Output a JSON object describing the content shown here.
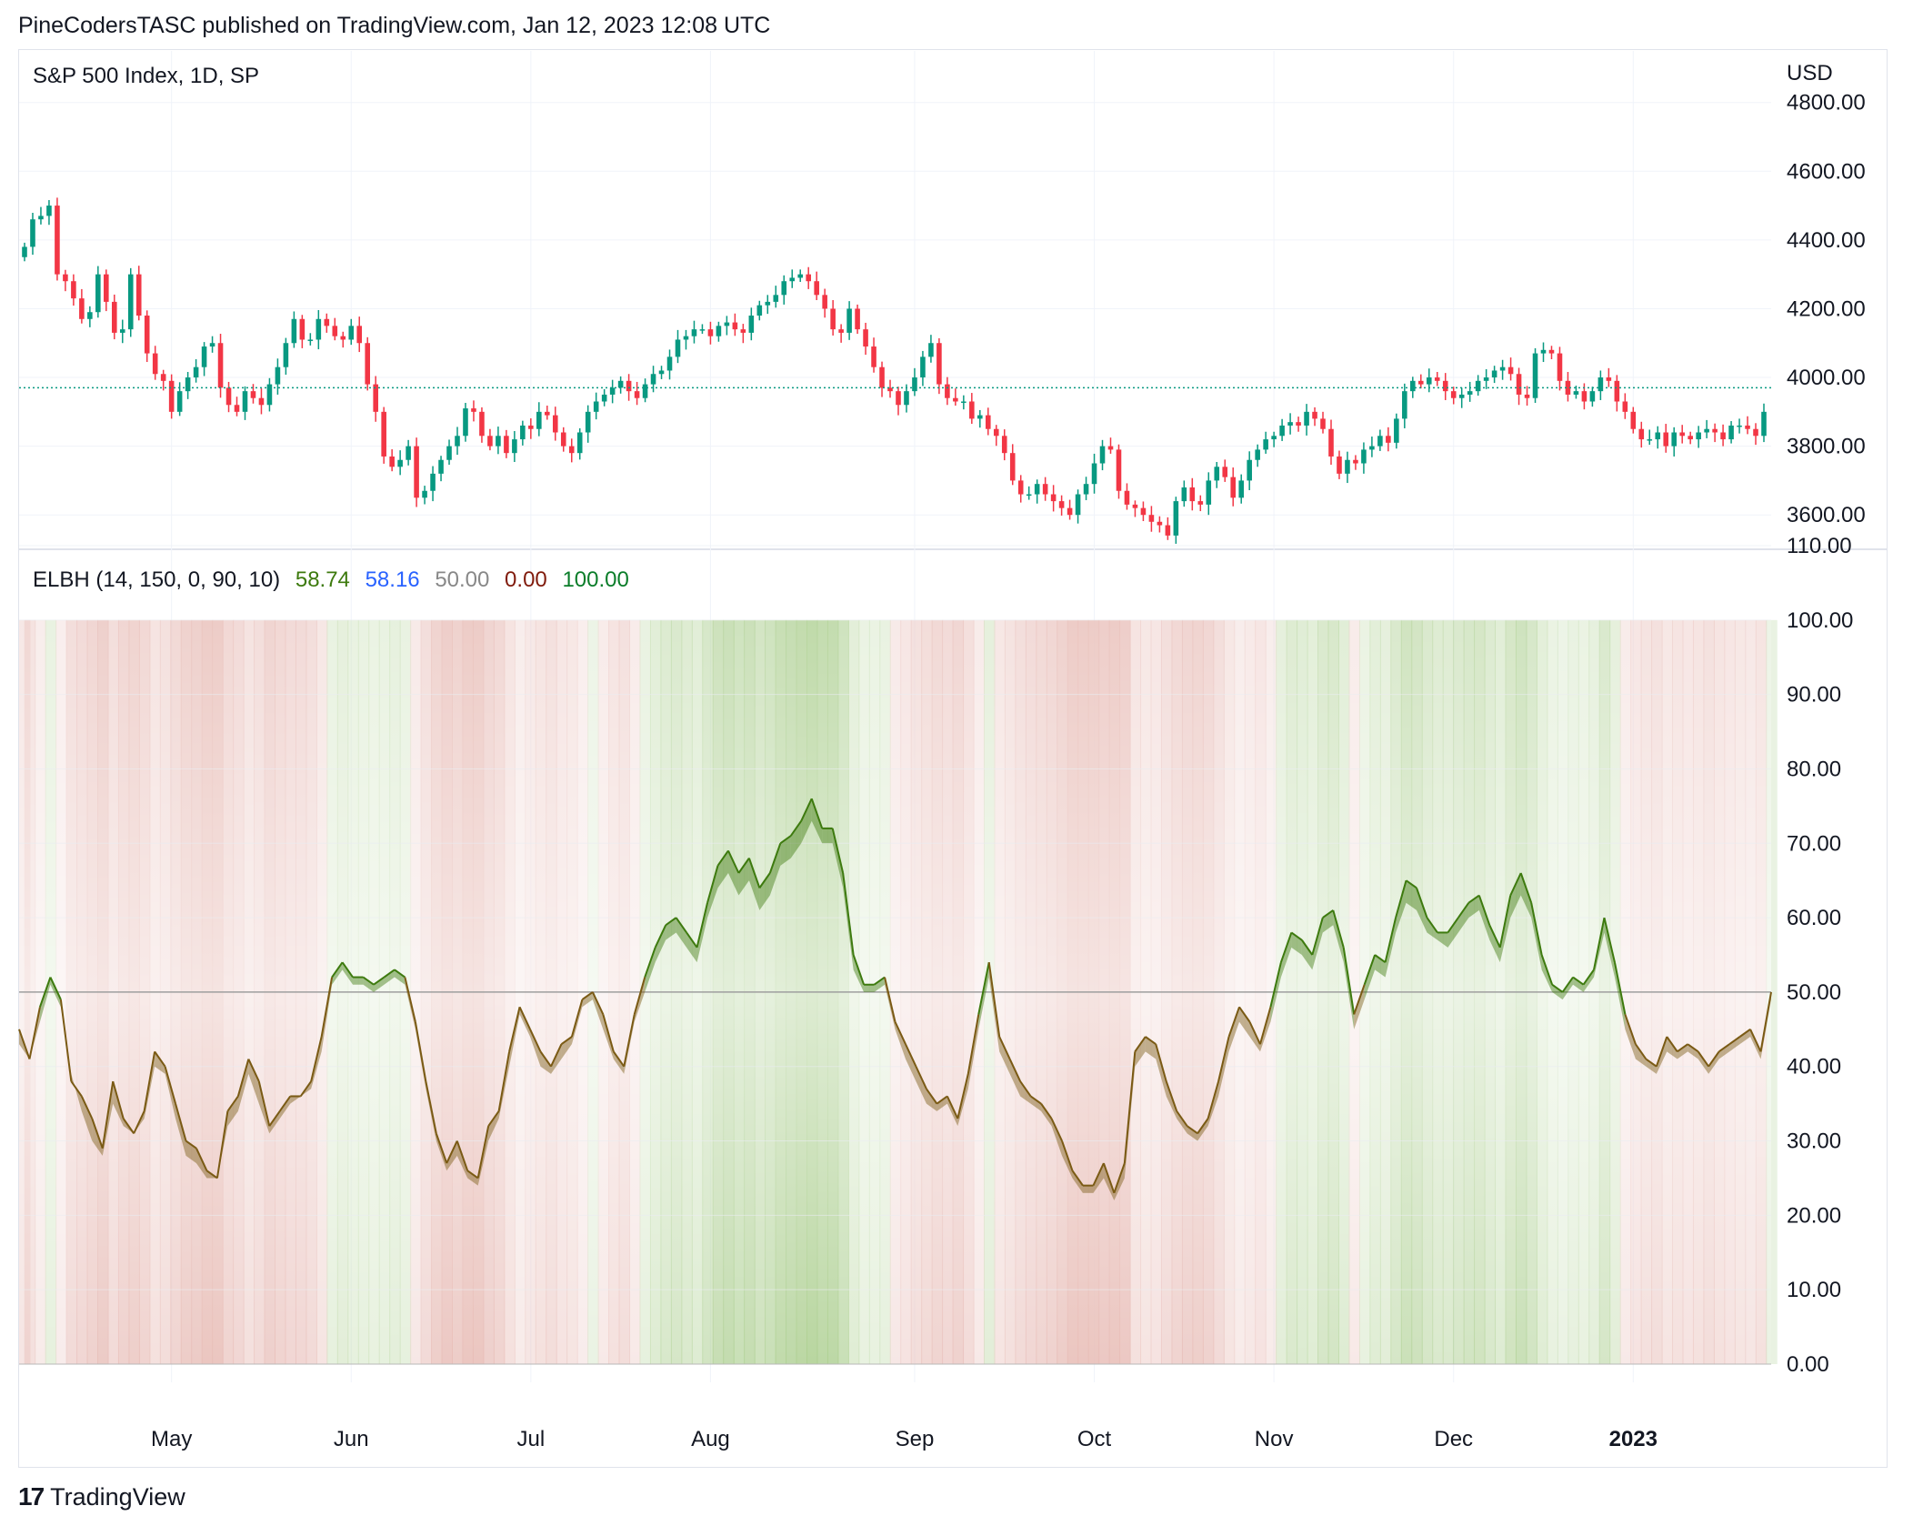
{
  "header": {
    "published": "PineCodersTASC published on TradingView.com, Jan 12, 2023 12:08 UTC"
  },
  "footer": {
    "brand": "TradingView",
    "logo_icon": "tradingview-logo-icon"
  },
  "chart_data": [
    {
      "type": "candlestick",
      "title": "S&P 500 Index, 1D, SP",
      "currency_label": "USD",
      "y_ticks": [
        "4800.00",
        "4600.00",
        "4400.00",
        "4200.00",
        "4000.00",
        "3800.00",
        "3600.00"
      ],
      "ylim": [
        3500,
        4950
      ],
      "last_price_line": 3970,
      "x_month_labels": [
        "May",
        "Jun",
        "Jul",
        "Aug",
        "Sep",
        "Oct",
        "Nov",
        "Dec",
        "2023"
      ],
      "grid": true,
      "colors": {
        "up": "#089981",
        "down": "#f23645",
        "price_line": "#089981"
      },
      "closes": [
        4380,
        4460,
        4470,
        4500,
        4300,
        4280,
        4230,
        4170,
        4190,
        4300,
        4220,
        4130,
        4140,
        4300,
        4180,
        4070,
        4010,
        3990,
        3900,
        3960,
        4000,
        4030,
        4090,
        4100,
        3970,
        3920,
        3900,
        3960,
        3940,
        3920,
        3980,
        4030,
        4100,
        4170,
        4110,
        4110,
        4170,
        4150,
        4120,
        4110,
        4150,
        4100,
        3980,
        3900,
        3770,
        3740,
        3760,
        3800,
        3650,
        3670,
        3720,
        3760,
        3800,
        3830,
        3910,
        3900,
        3830,
        3800,
        3830,
        3780,
        3820,
        3860,
        3850,
        3900,
        3890,
        3840,
        3800,
        3780,
        3840,
        3900,
        3930,
        3950,
        3970,
        3990,
        3960,
        3940,
        3980,
        4010,
        4020,
        4060,
        4110,
        4120,
        4140,
        4140,
        4120,
        4150,
        4160,
        4140,
        4130,
        4180,
        4210,
        4220,
        4240,
        4280,
        4290,
        4300,
        4280,
        4240,
        4200,
        4140,
        4130,
        4200,
        4140,
        4090,
        4030,
        3970,
        3960,
        3920,
        3960,
        4000,
        4060,
        4100,
        3980,
        3940,
        3930,
        3930,
        3880,
        3890,
        3850,
        3830,
        3780,
        3700,
        3660,
        3660,
        3690,
        3660,
        3640,
        3620,
        3600,
        3660,
        3690,
        3750,
        3800,
        3790,
        3670,
        3630,
        3620,
        3600,
        3580,
        3570,
        3540,
        3640,
        3680,
        3640,
        3630,
        3700,
        3740,
        3710,
        3650,
        3700,
        3760,
        3790,
        3820,
        3830,
        3860,
        3870,
        3860,
        3900,
        3880,
        3850,
        3770,
        3720,
        3760,
        3750,
        3790,
        3800,
        3830,
        3810,
        3880,
        3960,
        3990,
        3980,
        4000,
        3990,
        3960,
        3940,
        3950,
        3960,
        3990,
        4000,
        4020,
        4030,
        4010,
        3950,
        3940,
        4070,
        4080,
        4070,
        3990,
        3950,
        3960,
        3930,
        3960,
        4000,
        3990,
        3930,
        3900,
        3850,
        3820,
        3820,
        3840,
        3800,
        3840,
        3830,
        3820,
        3840,
        3850,
        3840,
        3820,
        3860,
        3860,
        3850,
        3830,
        3900
      ]
    },
    {
      "type": "line",
      "title": "ELBH (14, 150, 0, 90, 10)",
      "legend_values": [
        {
          "value": "58.74",
          "color": "#3d7a0e"
        },
        {
          "value": "58.16",
          "color": "#2962ff"
        },
        {
          "value": "50.00",
          "color": "#888888"
        },
        {
          "value": "0.00",
          "color": "#801b0c"
        },
        {
          "value": "100.00",
          "color": "#0b7d2a"
        }
      ],
      "y_ticks": [
        "110.00",
        "100.00",
        "90.00",
        "80.00",
        "70.00",
        "60.00",
        "50.00",
        "40.00",
        "30.00",
        "20.00",
        "10.00",
        "0.00"
      ],
      "ylim": [
        0,
        110
      ],
      "midline": 50,
      "band": [
        0,
        100
      ],
      "colors": {
        "bull": "#3d7a0e",
        "bear": "#7a5a14",
        "bg_bull": "#a8cc8a",
        "bg_bear": "#e6b8b2"
      },
      "series": [
        {
          "values": [
            45,
            41,
            48,
            52,
            49,
            38,
            36,
            33,
            29,
            38,
            33,
            31,
            34,
            42,
            40,
            35,
            30,
            29,
            26,
            25,
            34,
            36,
            41,
            38,
            32,
            34,
            36,
            36,
            38,
            44,
            52,
            54,
            52,
            52,
            51,
            52,
            53,
            52,
            46,
            38,
            31,
            27,
            30,
            26,
            25,
            32,
            34,
            42,
            48,
            45,
            42,
            40,
            43,
            44,
            49,
            50,
            47,
            42,
            40,
            47,
            52,
            56,
            59,
            60,
            58,
            56,
            62,
            67,
            69,
            66,
            68,
            64,
            66,
            70,
            71,
            73,
            76,
            72,
            72,
            66,
            55,
            51,
            51,
            52,
            46,
            43,
            40,
            37,
            35,
            36,
            33,
            39,
            47,
            54,
            44,
            41,
            38,
            36,
            35,
            33,
            30,
            26,
            24,
            24,
            27,
            23,
            27,
            42,
            44,
            43,
            38,
            34,
            32,
            31,
            33,
            38,
            44,
            48,
            46,
            43,
            48,
            54,
            58,
            57,
            55,
            60,
            61,
            56,
            47,
            51,
            55,
            54,
            60,
            65,
            64,
            60,
            58,
            58,
            60,
            62,
            63,
            59,
            56,
            63,
            66,
            62,
            55,
            51,
            50,
            52,
            51,
            53,
            60,
            54,
            47,
            43,
            41,
            40,
            44,
            42,
            43,
            42,
            40,
            42,
            43,
            44,
            45,
            42,
            50
          ]
        },
        {
          "values": [
            43,
            41,
            46,
            51,
            48,
            39,
            34,
            30,
            28,
            35,
            32,
            31,
            33,
            40,
            39,
            33,
            28,
            27,
            25,
            25,
            32,
            34,
            39,
            35,
            31,
            33,
            35,
            36,
            37,
            42,
            51,
            53,
            51,
            51,
            50,
            51,
            52,
            51,
            45,
            37,
            30,
            26,
            28,
            25,
            24,
            30,
            33,
            40,
            47,
            44,
            40,
            39,
            41,
            43,
            48,
            49,
            45,
            41,
            39,
            46,
            50,
            54,
            57,
            58,
            56,
            54,
            60,
            64,
            66,
            63,
            65,
            61,
            63,
            67,
            68,
            70,
            73,
            70,
            70,
            64,
            53,
            50,
            50,
            51,
            45,
            41,
            38,
            35,
            34,
            35,
            32,
            37,
            45,
            52,
            42,
            39,
            36,
            35,
            34,
            32,
            28,
            25,
            23,
            23,
            25,
            22,
            25,
            40,
            42,
            41,
            36,
            33,
            31,
            30,
            32,
            36,
            42,
            46,
            44,
            42,
            46,
            52,
            56,
            55,
            53,
            58,
            59,
            54,
            45,
            49,
            53,
            52,
            58,
            62,
            61,
            58,
            57,
            56,
            58,
            60,
            61,
            57,
            54,
            60,
            63,
            60,
            53,
            50,
            49,
            51,
            50,
            52,
            58,
            52,
            45,
            41,
            40,
            39,
            42,
            41,
            42,
            41,
            39,
            41,
            42,
            43,
            44,
            41,
            49
          ]
        }
      ]
    }
  ]
}
